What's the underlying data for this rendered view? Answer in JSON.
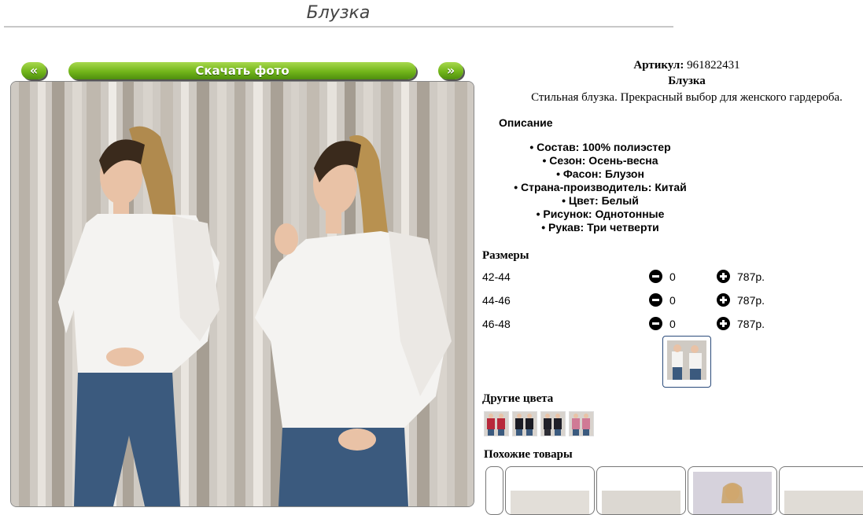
{
  "page": {
    "title": "Блузка"
  },
  "gallery": {
    "prev_label": "«",
    "next_label": "»",
    "download_label": "Скачать фото"
  },
  "product": {
    "article_label": "Артикул:",
    "article_value": "961822431",
    "name": "Блузка",
    "short_description": "Стильная блузка. Прекрасный выбор для женского гардероба.",
    "description_heading": "Описание",
    "features": [
      "Состав: 100% полиэстер",
      "Сезон: Осень-весна",
      "Фасон: Блузон",
      "Страна-производитель: Китай",
      "Цвет: Белый",
      "Рисунок: Однотонные",
      "Рукав: Три четверти"
    ]
  },
  "sizes": {
    "heading": "Размеры",
    "rows": [
      {
        "size": "42-44",
        "qty": "0",
        "price": "787р."
      },
      {
        "size": "44-46",
        "qty": "0",
        "price": "787р."
      },
      {
        "size": "46-48",
        "qty": "0",
        "price": "787р."
      }
    ]
  },
  "other_colors": {
    "heading": "Другие цвета",
    "swatches": [
      "#b8283a",
      "#1c1c24",
      "#1f1f28",
      "#d07a95"
    ]
  },
  "similar": {
    "heading": "Похожие товары"
  },
  "colors": {
    "accent_green": "#6fb31b",
    "blouse": "#f4f3f1",
    "jeans": "#3b5a7e"
  }
}
